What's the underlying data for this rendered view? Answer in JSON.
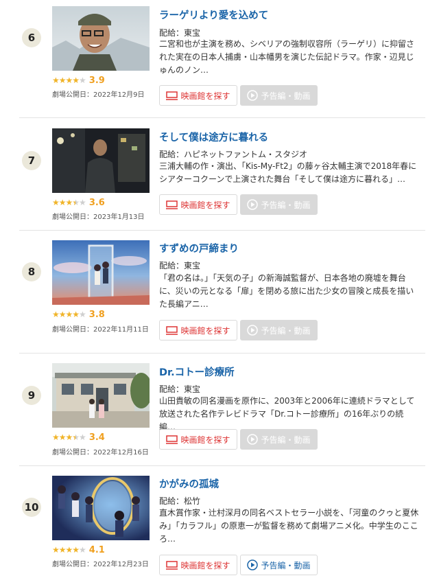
{
  "colors": {
    "title_link": "#1a64a8",
    "star": "#f0b429",
    "score": "#f0a020",
    "theater_red": "#dd3333",
    "disabled_gray": "#d9d9d9",
    "rank_bg": "#ebe8da"
  },
  "items": [
    {
      "rank": "6",
      "title": "ラーゲリより愛を込めて",
      "distributor": "配給：東宝",
      "synopsis": "二宮和也が主演を務め、シベリアの強制収容所（ラーゲリ）に抑留された実在の日本人捕虜・山本幡男を演じた伝記ドラマ。作家・辺見じゅんのノン…",
      "rating": "3.9",
      "stars": 4,
      "release": "劇場公開日：2022年12月9日",
      "theater_button": "映画館を探す",
      "trailer_button": "予告編・動画",
      "trailer_enabled": false,
      "poster_icon": "snowy-portrait-image"
    },
    {
      "rank": "7",
      "title": "そして僕は途方に暮れる",
      "distributor": "配給：ハピネットファントム・スタジオ",
      "synopsis": "三浦大輔の作・演出、「Kis-My-Ft2」の藤ヶ谷太輔主演で2018年春にシアターコクーンで上演された舞台「そして僕は途方に暮れる」…",
      "rating": "3.6",
      "stars": 3.5,
      "release": "劇場公開日：2023年1月13日",
      "theater_button": "映画館を探す",
      "trailer_button": "予告編・動画",
      "trailer_enabled": false,
      "poster_icon": "night-street-image"
    },
    {
      "rank": "8",
      "title": "すずめの戸締まり",
      "distributor": "配給：東宝",
      "synopsis": "「君の名は。」「天気の子」の新海誠監督が、日本各地の廃墟を舞台に、災いの元となる「扉」を閉める旅に出た少女の冒険と成長を描いた長編アニ…",
      "rating": "3.8",
      "stars": 4,
      "release": "劇場公開日：2022年11月11日",
      "theater_button": "映画館を探す",
      "trailer_button": "予告編・動画",
      "trailer_enabled": false,
      "poster_icon": "anime-door-sky-image"
    },
    {
      "rank": "9",
      "title": "Dr.コトー診療所",
      "distributor": "配給：東宝",
      "synopsis": "山田貴敏の同名漫画を原作に、2003年と2006年に連続ドラマとして放送された名作テレビドラマ「Dr.コトー診療所」の16年ぶりの続編…",
      "rating": "3.4",
      "stars": 3.5,
      "release": "劇場公開日：2022年12月16日",
      "theater_button": "映画館を探す",
      "trailer_button": "予告編・動画",
      "trailer_enabled": false,
      "poster_icon": "clinic-building-image"
    },
    {
      "rank": "10",
      "title": "かがみの孤城",
      "distributor": "配給：松竹",
      "synopsis": "直木賞作家・辻村深月の同名ベストセラー小説を、「河童のクゥと夏休み」「カラフル」の原恵一が監督を務めて劇場アニメ化。中学生のこころ…",
      "rating": "4.1",
      "stars": 4,
      "release": "劇場公開日：2022年12月23日",
      "theater_button": "映画館を探す",
      "trailer_button": "予告編・動画",
      "trailer_enabled": true,
      "poster_icon": "anime-mirror-castle-image"
    }
  ]
}
